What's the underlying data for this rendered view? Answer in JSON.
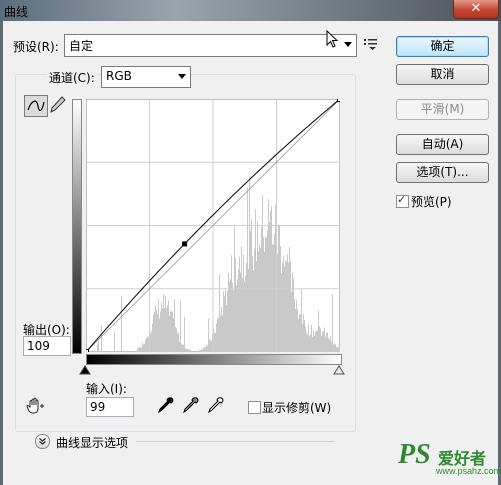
{
  "window": {
    "title": "曲线",
    "close_glyph": "✕"
  },
  "preset": {
    "label": "预设(R):",
    "value": "自定"
  },
  "channel": {
    "label": "通道(C):",
    "value": "RGB"
  },
  "buttons": {
    "ok": "确定",
    "cancel": "取消",
    "smooth": "平滑(M)",
    "auto": "自动(A)",
    "options": "选项(T)..."
  },
  "preview": {
    "label": "预览(P)",
    "checked": true
  },
  "output": {
    "label": "输出(O):",
    "value": "109"
  },
  "input": {
    "label": "输入(I):",
    "value": "99"
  },
  "clipping": {
    "label": "显示修剪(W)",
    "checked": false
  },
  "curve_display_options": {
    "label": "曲线显示选项"
  },
  "watermark": {
    "brand": "PS",
    "text": "爱好者",
    "url": "www.psahz.com"
  },
  "curve": {
    "point_in": 99,
    "point_out": 109
  }
}
